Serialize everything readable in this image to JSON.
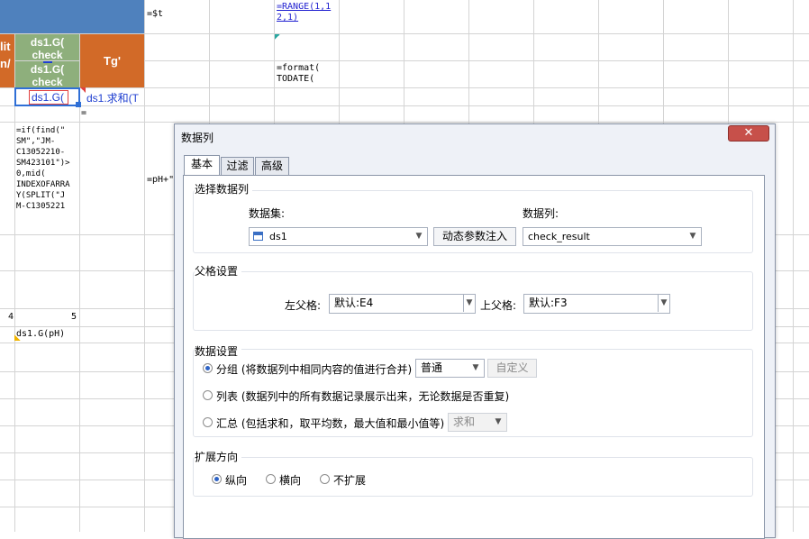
{
  "sheet": {
    "c_top": "=$t",
    "range_formula": "=RANGE(1,1 2,1)",
    "range_line1": "=RANGE(1,1",
    "range_line2": "2,1)",
    "format_line1": "=format(",
    "format_line2": "TODATE(",
    "orange_left_1": "lit",
    "orange_left_2": "n/",
    "green_top_1": "ds1.G(",
    "green_top_2": "check",
    "green_bottom_1": "ds1.G(",
    "green_bottom_2": "check",
    "tg_header": "Tg'",
    "selected_cell": "ds1.G(",
    "sum_cell": "ds1.求和(T",
    "equals": "=",
    "formula_lines": [
      "=if(find(\"",
      "SM\",\"JM-",
      "C13052210-",
      "SM423101\")>",
      "0,mid(",
      "INDEXOFARRA",
      "Y(SPLIT(\"J",
      "M-C1305221"
    ],
    "ph_cell": "=pH+\"",
    "row_num_4": "4",
    "row_num_5": "5",
    "ph_group": "ds1.G(pH)"
  },
  "dialog": {
    "title": "数据列",
    "close_label": "✕",
    "tabs": [
      "基本",
      "过滤",
      "高级"
    ],
    "select_section": {
      "title": "选择数据列",
      "dataset_label": "数据集:",
      "dataset_value": "ds1",
      "dataset_icon": "table-icon",
      "dynamic_button": "动态参数注入",
      "column_label": "数据列:",
      "column_value": "check_result"
    },
    "parent_section": {
      "title": "父格设置",
      "left_label": "左父格:",
      "left_value": "默认:E4",
      "top_label": "上父格:",
      "top_value": "默认:F3"
    },
    "data_section": {
      "title": "数据设置",
      "group_label": "分组 (将数据列中相同内容的值进行合并)",
      "group_mode": "普通",
      "custom_button": "自定义",
      "list_label": "列表 (数据列中的所有数据记录展示出来，无论数据是否重复)",
      "summary_label": "汇总 (包括求和，取平均数，最大值和最小值等)",
      "summary_mode": "求和"
    },
    "expand_section": {
      "title": "扩展方向",
      "vertical": "纵向",
      "horizontal": "横向",
      "none": "不扩展"
    }
  }
}
